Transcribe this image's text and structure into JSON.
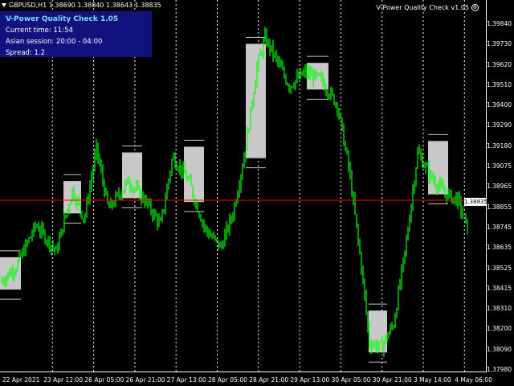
{
  "header": {
    "symbol_text": "GBPUSD,H1  1.38690 1.38840 1.38643 1.38835"
  },
  "indicator": {
    "name": "V-Power Quality Check v1.05",
    "icon": "gear-icon"
  },
  "panel": {
    "title": "V-Power Quality Check 1.05",
    "current_time": "Current time: 11:54",
    "session": "Asian session: 20:00 - 04:00",
    "spread": "Spread: 1.2"
  },
  "current_price": "1.38835",
  "colors": {
    "background": "#000000",
    "candles": "#00ff00",
    "session_boxes": "#c8c8c8",
    "price_line": "#ff0000",
    "panel_bg": "#12127e",
    "grid": "#ffffff"
  },
  "price_axis": [
    "1.39840",
    "1.39730",
    "1.39620",
    "1.39510",
    "1.39400",
    "1.39290",
    "1.39180",
    "1.39075",
    "1.38965",
    "1.38855",
    "1.38745",
    "1.38635",
    "1.38525",
    "1.38415",
    "1.38310",
    "1.38200",
    "1.38090",
    "1.37980"
  ],
  "time_axis": [
    "22 Apr 2021",
    "23 Apr 12:00",
    "26 Apr 05:00",
    "26 Apr 21:00",
    "27 Apr 13:00",
    "28 Apr 05:00",
    "28 Apr 21:00",
    "29 Apr 13:00",
    "30 Apr 05:00",
    "30 Apr 21:00",
    "3 May 14:00",
    "4 May 06:00"
  ],
  "chart_data": {
    "type": "candlestick",
    "symbol": "GBPUSD",
    "timeframe": "H1",
    "ylim": [
      1.3795,
      1.399
    ],
    "current_price": 1.38835,
    "session_boxes": [
      {
        "start": "22 Apr 2021",
        "open": 1.3855,
        "close": 1.3838
      },
      {
        "start": "23 Apr 12:00",
        "open": 1.3878,
        "close": 1.3895
      },
      {
        "start": "26 Apr 05:00",
        "open": 1.391,
        "close": 1.3886
      },
      {
        "start": "26 Apr 21:00",
        "open": 1.3884,
        "close": 1.3913
      },
      {
        "start": "28 Apr 05:00",
        "open": 1.3907,
        "close": 1.3967
      },
      {
        "start": "28 Apr 21:00",
        "open": 1.3943,
        "close": 1.3957
      },
      {
        "start": "30 Apr 05:00",
        "open": 1.3827,
        "close": 1.3805
      },
      {
        "start": "3 May 14:00",
        "open": 1.3888,
        "close": 1.3916
      }
    ]
  }
}
